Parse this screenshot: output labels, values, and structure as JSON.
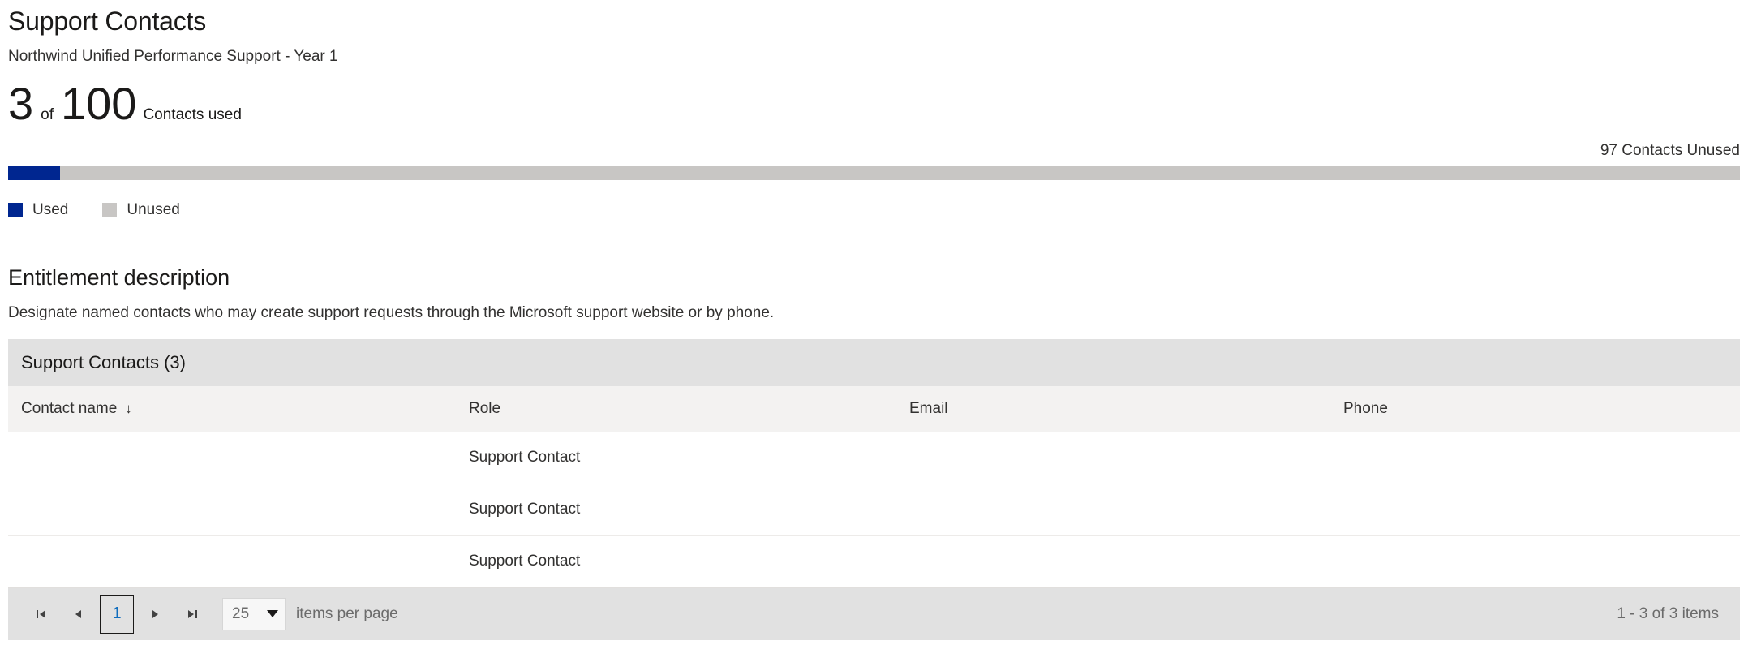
{
  "header": {
    "title": "Support Contacts",
    "subtitle": "Northwind Unified Performance Support - Year 1"
  },
  "usage": {
    "used": "3",
    "of_word": "of",
    "total": "100",
    "unit_label": "Contacts used",
    "remaining_caption": "97 Contacts Unused",
    "used_percent": 3,
    "bar_colors": {
      "used": "#002690",
      "unused": "#c8c6c4"
    },
    "legend": [
      {
        "label": "Used",
        "color": "#002690",
        "swatch": "used"
      },
      {
        "label": "Unused",
        "color": "#c8c6c4",
        "swatch": "unused"
      }
    ]
  },
  "entitlement": {
    "title": "Entitlement description",
    "description": "Designate named contacts who may create support requests through the Microsoft support website or by phone."
  },
  "table": {
    "caption": "Support Contacts (3)",
    "sort_indicator": "↓",
    "columns": [
      {
        "key": "name",
        "label": "Contact name",
        "sorted": true
      },
      {
        "key": "role",
        "label": "Role",
        "sorted": false
      },
      {
        "key": "email",
        "label": "Email",
        "sorted": false
      },
      {
        "key": "phone",
        "label": "Phone",
        "sorted": false
      }
    ],
    "rows": [
      {
        "name": "",
        "role": "Support Contact",
        "email": "",
        "phone": ""
      },
      {
        "name": "",
        "role": "Support Contact",
        "email": "",
        "phone": ""
      },
      {
        "name": "",
        "role": "Support Contact",
        "email": "",
        "phone": ""
      }
    ]
  },
  "pagination": {
    "first_icon": "first-page-icon",
    "prev_icon": "previous-page-icon",
    "next_icon": "next-page-icon",
    "last_icon": "last-page-icon",
    "current_page": "1",
    "page_size": "25",
    "page_size_options": [
      "25"
    ],
    "items_per_page_label": "items per page",
    "summary": "1 - 3 of 3 items"
  }
}
